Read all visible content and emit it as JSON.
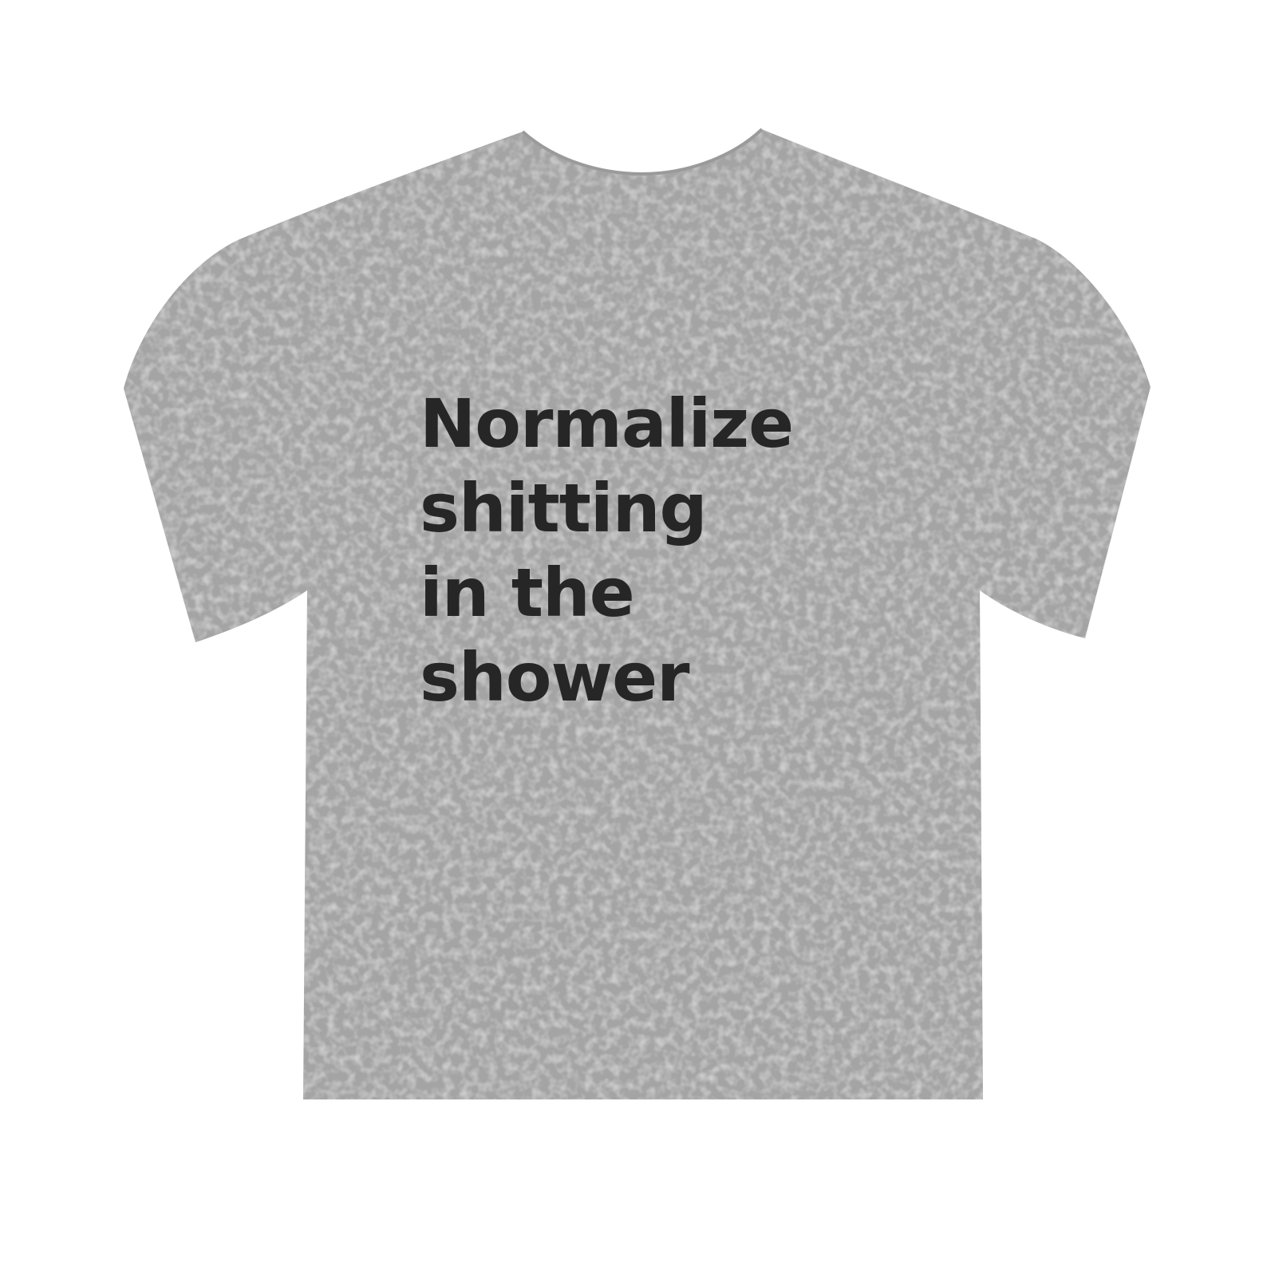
{
  "product": {
    "type": "t-shirt",
    "shirt_color": "#a4a4a4",
    "background_color": "#ffffff",
    "print_color": "#262626",
    "print_lines": [
      "Normalize",
      "shitting",
      "in the",
      "shower"
    ]
  }
}
